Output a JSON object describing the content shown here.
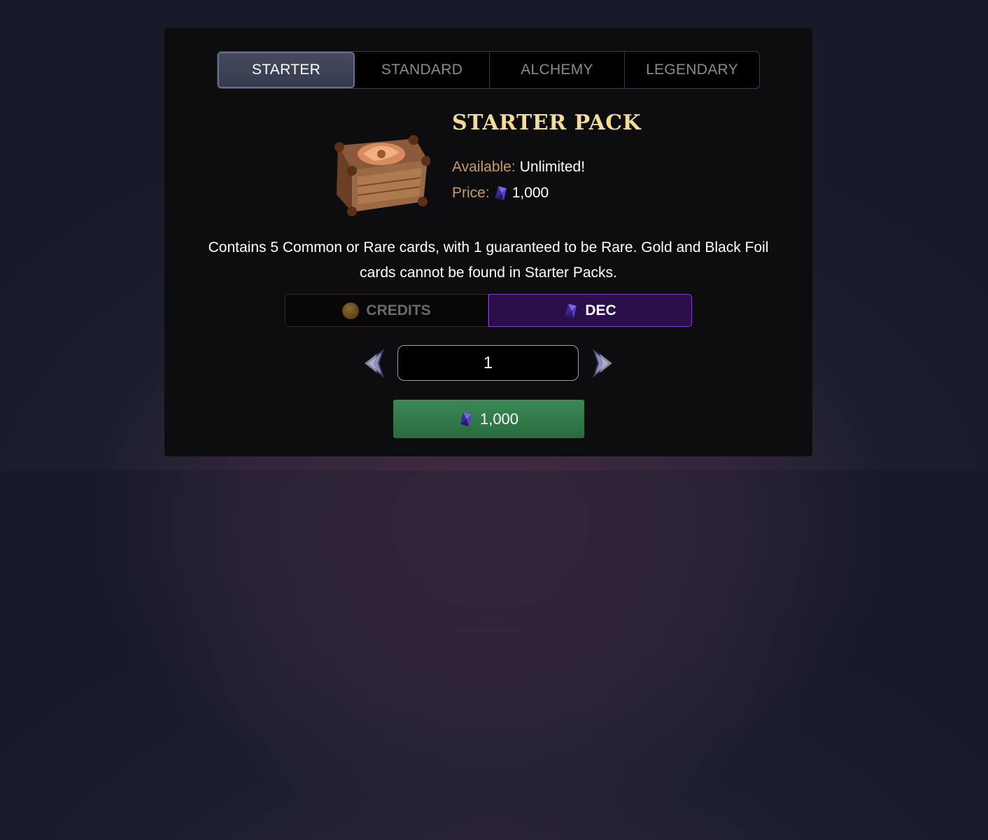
{
  "tabs": [
    {
      "label": "STARTER",
      "active": true
    },
    {
      "label": "STANDARD",
      "active": false
    },
    {
      "label": "ALCHEMY",
      "active": false
    },
    {
      "label": "LEGENDARY",
      "active": false
    }
  ],
  "pack": {
    "title": "STARTER PACK",
    "image_icon": "chest-icon",
    "available_label": "Available:",
    "available_value": "Unlimited!",
    "price_label": "Price:",
    "price_value": "1,000",
    "price_icon": "dec-gem-icon"
  },
  "description": "Contains 5 Common or Rare cards, with 1 guaranteed to be Rare. Gold and Black Foil cards cannot be found in Starter Packs.",
  "currency": {
    "credits_label": "CREDITS",
    "dec_label": "DEC",
    "selected": "DEC"
  },
  "quantity": {
    "value": "1",
    "prev_icon": "chevron-left-icon",
    "next_icon": "chevron-right-icon"
  },
  "buy_button": {
    "amount": "1,000",
    "icon": "dec-gem-icon"
  },
  "colors": {
    "title": "#f3dc96",
    "label": "#c89a64",
    "dec_active": "#2a0f4a",
    "buy": "#3a8a55"
  }
}
